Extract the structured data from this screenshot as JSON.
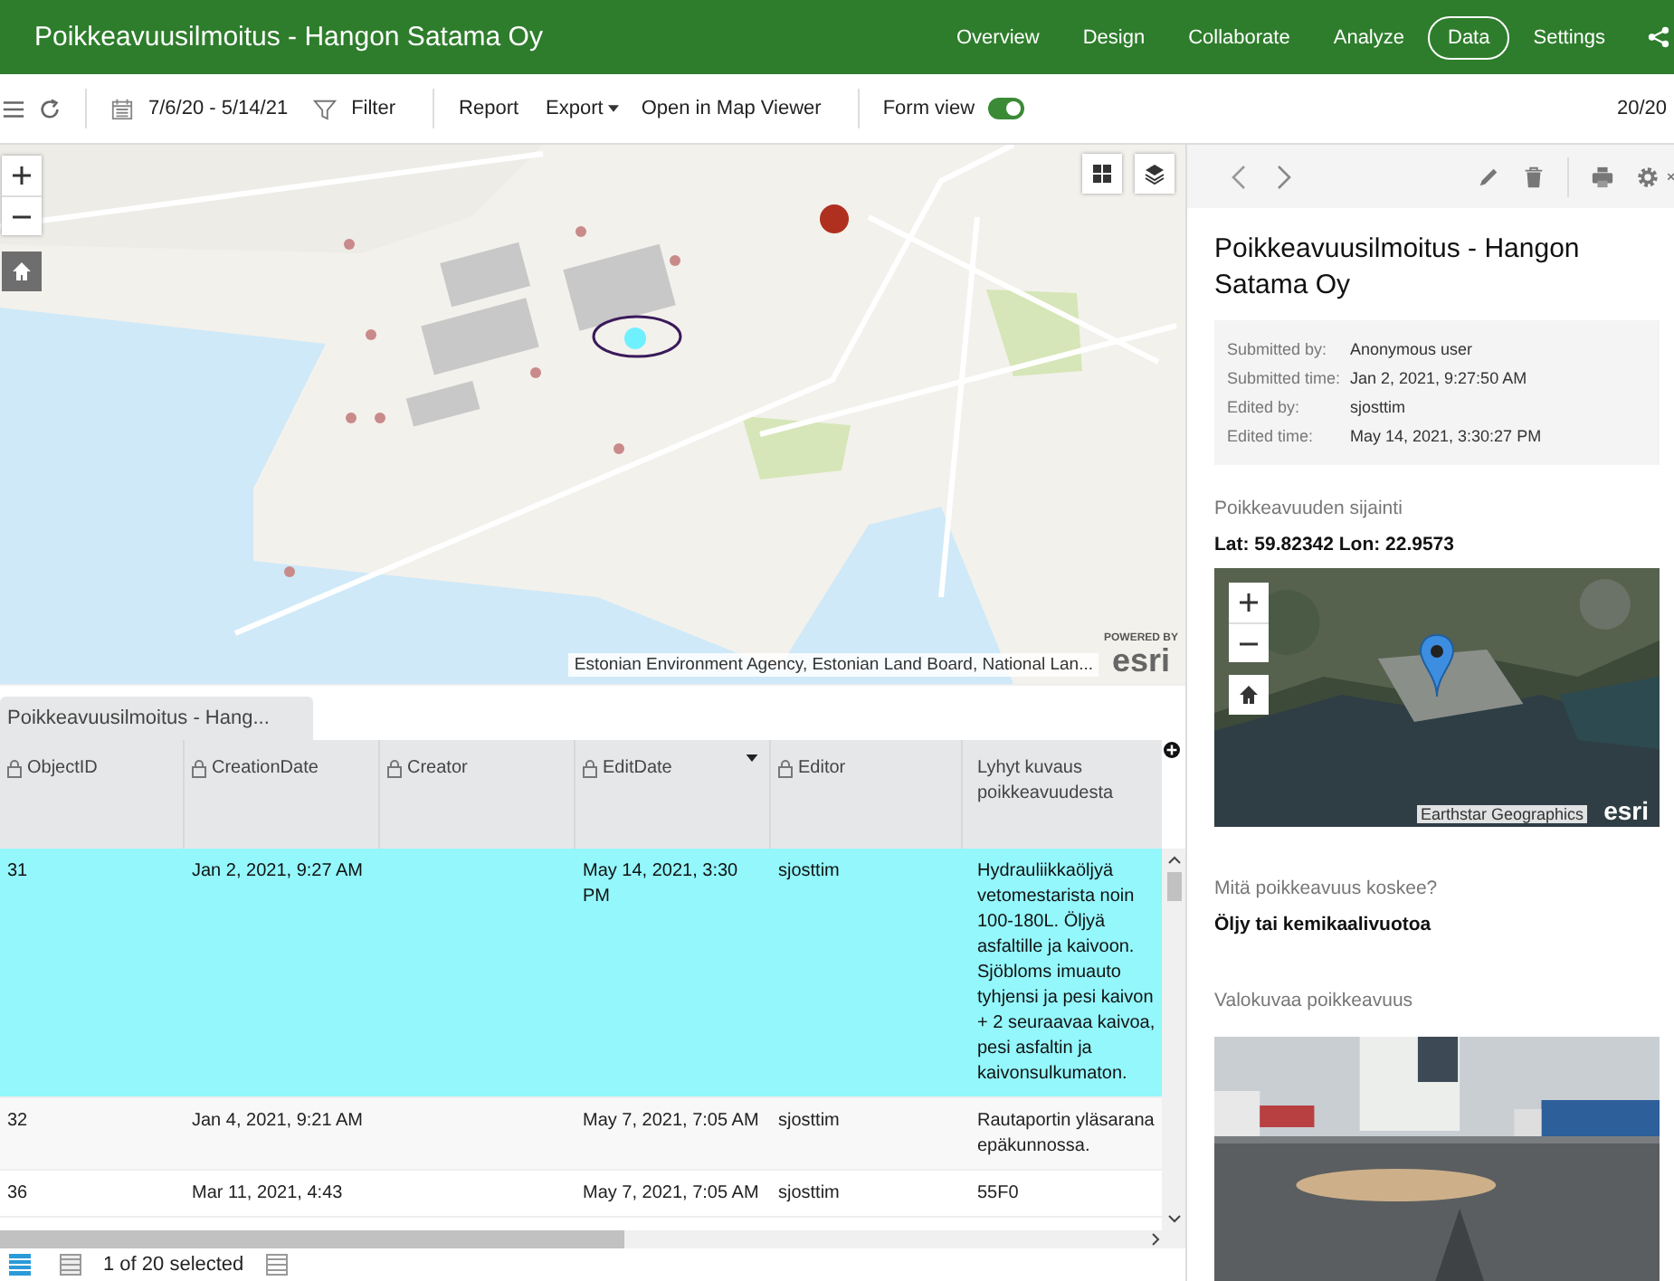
{
  "header": {
    "title": "Poikkeavuusilmoitus - Hangon Satama Oy",
    "nav": [
      {
        "label": "Overview",
        "selected": false
      },
      {
        "label": "Design",
        "selected": false
      },
      {
        "label": "Collaborate",
        "selected": false
      },
      {
        "label": "Analyze",
        "selected": false
      },
      {
        "label": "Data",
        "selected": true
      },
      {
        "label": "Settings",
        "selected": false
      }
    ]
  },
  "toolbar": {
    "date_range": "7/6/20 - 5/14/21",
    "filter": "Filter",
    "report": "Report",
    "export": "Export",
    "open_map": "Open in Map Viewer",
    "form_view": {
      "label": "Form view",
      "on": true
    },
    "count": "20/20"
  },
  "map": {
    "attribution": "Estonian Environment Agency, Estonian Land Board, National Lan...",
    "logo_top": "POWERED BY",
    "logo": "esri"
  },
  "table": {
    "tab_label": "Poikkeavuusilmoitus - Hang...",
    "columns": [
      {
        "label": "ObjectID",
        "sorted": false
      },
      {
        "label": "CreationDate",
        "sorted": false
      },
      {
        "label": "Creator",
        "sorted": false
      },
      {
        "label": "EditDate",
        "sorted": true
      },
      {
        "label": "Editor",
        "sorted": false
      },
      {
        "label": "Lyhyt kuvaus poikkeavuudesta",
        "sorted": false
      }
    ],
    "rows": [
      {
        "selected": true,
        "cells": [
          "31",
          "Jan 2, 2021, 9:27 AM",
          "",
          "May 14, 2021, 3:30 PM",
          "sjosttim",
          "Hydrauliikkaöljyä vetomestarista noin 100-180L. Öljyä asfaltille ja kaivoon. Sjöbloms imuauto tyhjensi ja pesi kaivon + 2 seuraavaa kaivoa, pesi asfaltin ja kaivonsulkumaton."
        ]
      },
      {
        "selected": false,
        "cells": [
          "32",
          "Jan 4, 2021, 9:21 AM",
          "",
          "May 7, 2021, 7:05 AM",
          "sjosttim",
          "Rautaportin yläsarana epäkunnossa."
        ]
      },
      {
        "selected": false,
        "cells": [
          "36",
          "Mar 11, 2021, 4:43",
          "",
          "May 7, 2021, 7:05 AM",
          "sjosttim",
          "55F0"
        ]
      }
    ]
  },
  "footer": {
    "selection": "1 of 20 selected"
  },
  "panel": {
    "title": "Poikkeavuusilmoitus - Hangon Satama Oy",
    "meta": [
      {
        "label": "Submitted by:",
        "value": "Anonymous user"
      },
      {
        "label": "Submitted time:",
        "value": "Jan 2, 2021, 9:27:50 AM"
      },
      {
        "label": "Edited by:",
        "value": "sjosttim"
      },
      {
        "label": "Edited time:",
        "value": "May 14, 2021, 3:30:27 PM"
      }
    ],
    "fields": [
      {
        "kind": "location",
        "label": "Poikkeavuuden sijainti",
        "value": "Lat: 59.82342 Lon: 22.9573",
        "attribution": "Earthstar Geographics",
        "logo": "esri"
      },
      {
        "kind": "text",
        "label": "Mitä poikkeavuus koskee?",
        "value": "Öljy tai kemikaalivuotoa"
      },
      {
        "label": "Valokuvaa poikkeavuus"
      }
    ]
  }
}
